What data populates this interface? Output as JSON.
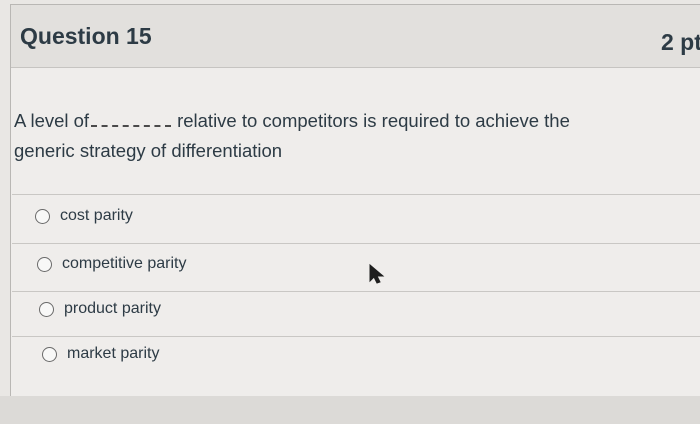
{
  "question": {
    "title": "Question 15",
    "points": "2 pt",
    "text_before_blank": "A level of",
    "text_after_blank": "relative to competitors is required to achieve the",
    "text_line2": "generic strategy of differentiation"
  },
  "answers": [
    {
      "label": "cost parity"
    },
    {
      "label": "competitive parity"
    },
    {
      "label": "product parity"
    },
    {
      "label": "market parity"
    }
  ],
  "icons": {
    "cursor": "mouse-pointer-icon",
    "radio": "radio-button-unselected"
  }
}
